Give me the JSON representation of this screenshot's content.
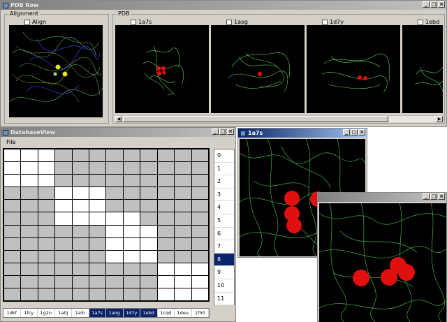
{
  "pdb_row_window": {
    "title": "PDB Row",
    "alignment_group": {
      "label": "Alignment",
      "checkbox_label": "Align"
    },
    "pdb_group": {
      "label": "PDB",
      "panels": [
        {
          "checkbox_label": "1a7s"
        },
        {
          "checkbox_label": "1aog"
        },
        {
          "checkbox_label": "1d7y"
        },
        {
          "checkbox_label": "1ebd"
        }
      ]
    },
    "scroll_left": "◀",
    "scroll_right": "▶"
  },
  "database_view": {
    "title": "DatabaseView",
    "menu": [
      "File"
    ],
    "grid_rows": [
      [
        0,
        0,
        0,
        1,
        1,
        1,
        1,
        1,
        1,
        1,
        1,
        1
      ],
      [
        0,
        0,
        0,
        1,
        1,
        1,
        1,
        1,
        1,
        1,
        1,
        1
      ],
      [
        0,
        0,
        0,
        1,
        1,
        1,
        1,
        1,
        1,
        1,
        1,
        1
      ],
      [
        1,
        1,
        1,
        0,
        0,
        0,
        1,
        1,
        1,
        1,
        1,
        1
      ],
      [
        1,
        1,
        1,
        0,
        0,
        0,
        1,
        1,
        1,
        1,
        1,
        1
      ],
      [
        1,
        1,
        1,
        0,
        0,
        0,
        0,
        0,
        1,
        1,
        1,
        1
      ],
      [
        1,
        1,
        1,
        1,
        1,
        1,
        0,
        0,
        0,
        1,
        1,
        1
      ],
      [
        1,
        1,
        1,
        1,
        1,
        1,
        0,
        0,
        0,
        1,
        1,
        1
      ],
      [
        1,
        1,
        1,
        1,
        1,
        1,
        0,
        0,
        0,
        1,
        1,
        1
      ],
      [
        1,
        1,
        1,
        1,
        1,
        1,
        1,
        1,
        1,
        0,
        0,
        0
      ],
      [
        1,
        1,
        1,
        1,
        1,
        1,
        1,
        1,
        1,
        0,
        0,
        0
      ],
      [
        1,
        1,
        1,
        1,
        1,
        1,
        1,
        1,
        1,
        0,
        0,
        0
      ]
    ],
    "row_numbers": [
      "0",
      "1",
      "2",
      "3",
      "4",
      "5",
      "6",
      "7",
      "8",
      "9",
      "10",
      "11"
    ],
    "selected_row": "8",
    "pdb_ids": [
      "1dkf",
      "1fcy",
      "1g2n",
      "1a0j",
      "1a5i",
      "1a7s",
      "1aog",
      "1d7y",
      "1ebd",
      "1cqd",
      "1deu",
      "1fh0"
    ],
    "selected_pdb_ids": [
      "1a7s",
      "1aog",
      "1d7y",
      "1ebd"
    ]
  },
  "viewer_1a7s": {
    "title": "1a7s"
  },
  "viewer_second": {
    "title": ""
  },
  "colors": {
    "active_title": "#0a246a",
    "grid_on": "#c0c0c0",
    "atom_red": "#e01010",
    "backbone_green": "#5fd35f",
    "atom_yellow": "#e6e600"
  }
}
